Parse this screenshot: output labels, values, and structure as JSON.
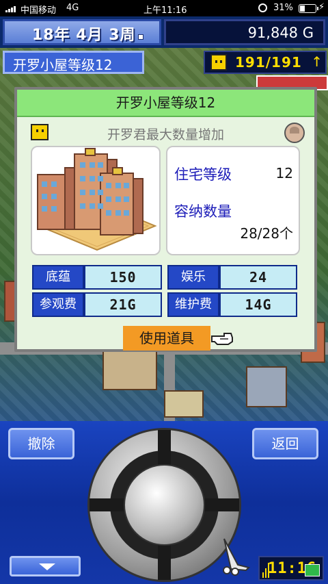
{
  "statusbar": {
    "carrier": "中国移动",
    "network": "4G",
    "time": "上午11:16",
    "battery_pct": "31%",
    "battery_level": 0.31
  },
  "top": {
    "date": "18年 4月 3周",
    "money": "91,848 G"
  },
  "facility_title": "开罗小屋等级12",
  "capacity": {
    "value": "191/191",
    "arrow": "↑"
  },
  "dialog": {
    "title": "开罗小屋等级12",
    "subtitle": "开罗君最大数量增加",
    "info": {
      "level_label": "住宅等级",
      "level_value": "12",
      "capacity_label": "容纳数量",
      "capacity_value": "28/28个"
    },
    "stats": [
      {
        "label": "底蕴",
        "value": "150"
      },
      {
        "label": "娱乐",
        "value": "24"
      },
      {
        "label": "参观费",
        "value": "21G"
      },
      {
        "label": "维护费",
        "value": "14G"
      }
    ],
    "use_item": "使用道具"
  },
  "controls": {
    "remove": "撤除",
    "back": "返回",
    "clock": "11:16"
  },
  "colors": {
    "header_green": "#8ce67a",
    "stat_blue": "#2448c6",
    "stat_cyan": "#c6ecf5",
    "use_orange": "#f39a24",
    "ui_blue": "#3a64d8"
  }
}
